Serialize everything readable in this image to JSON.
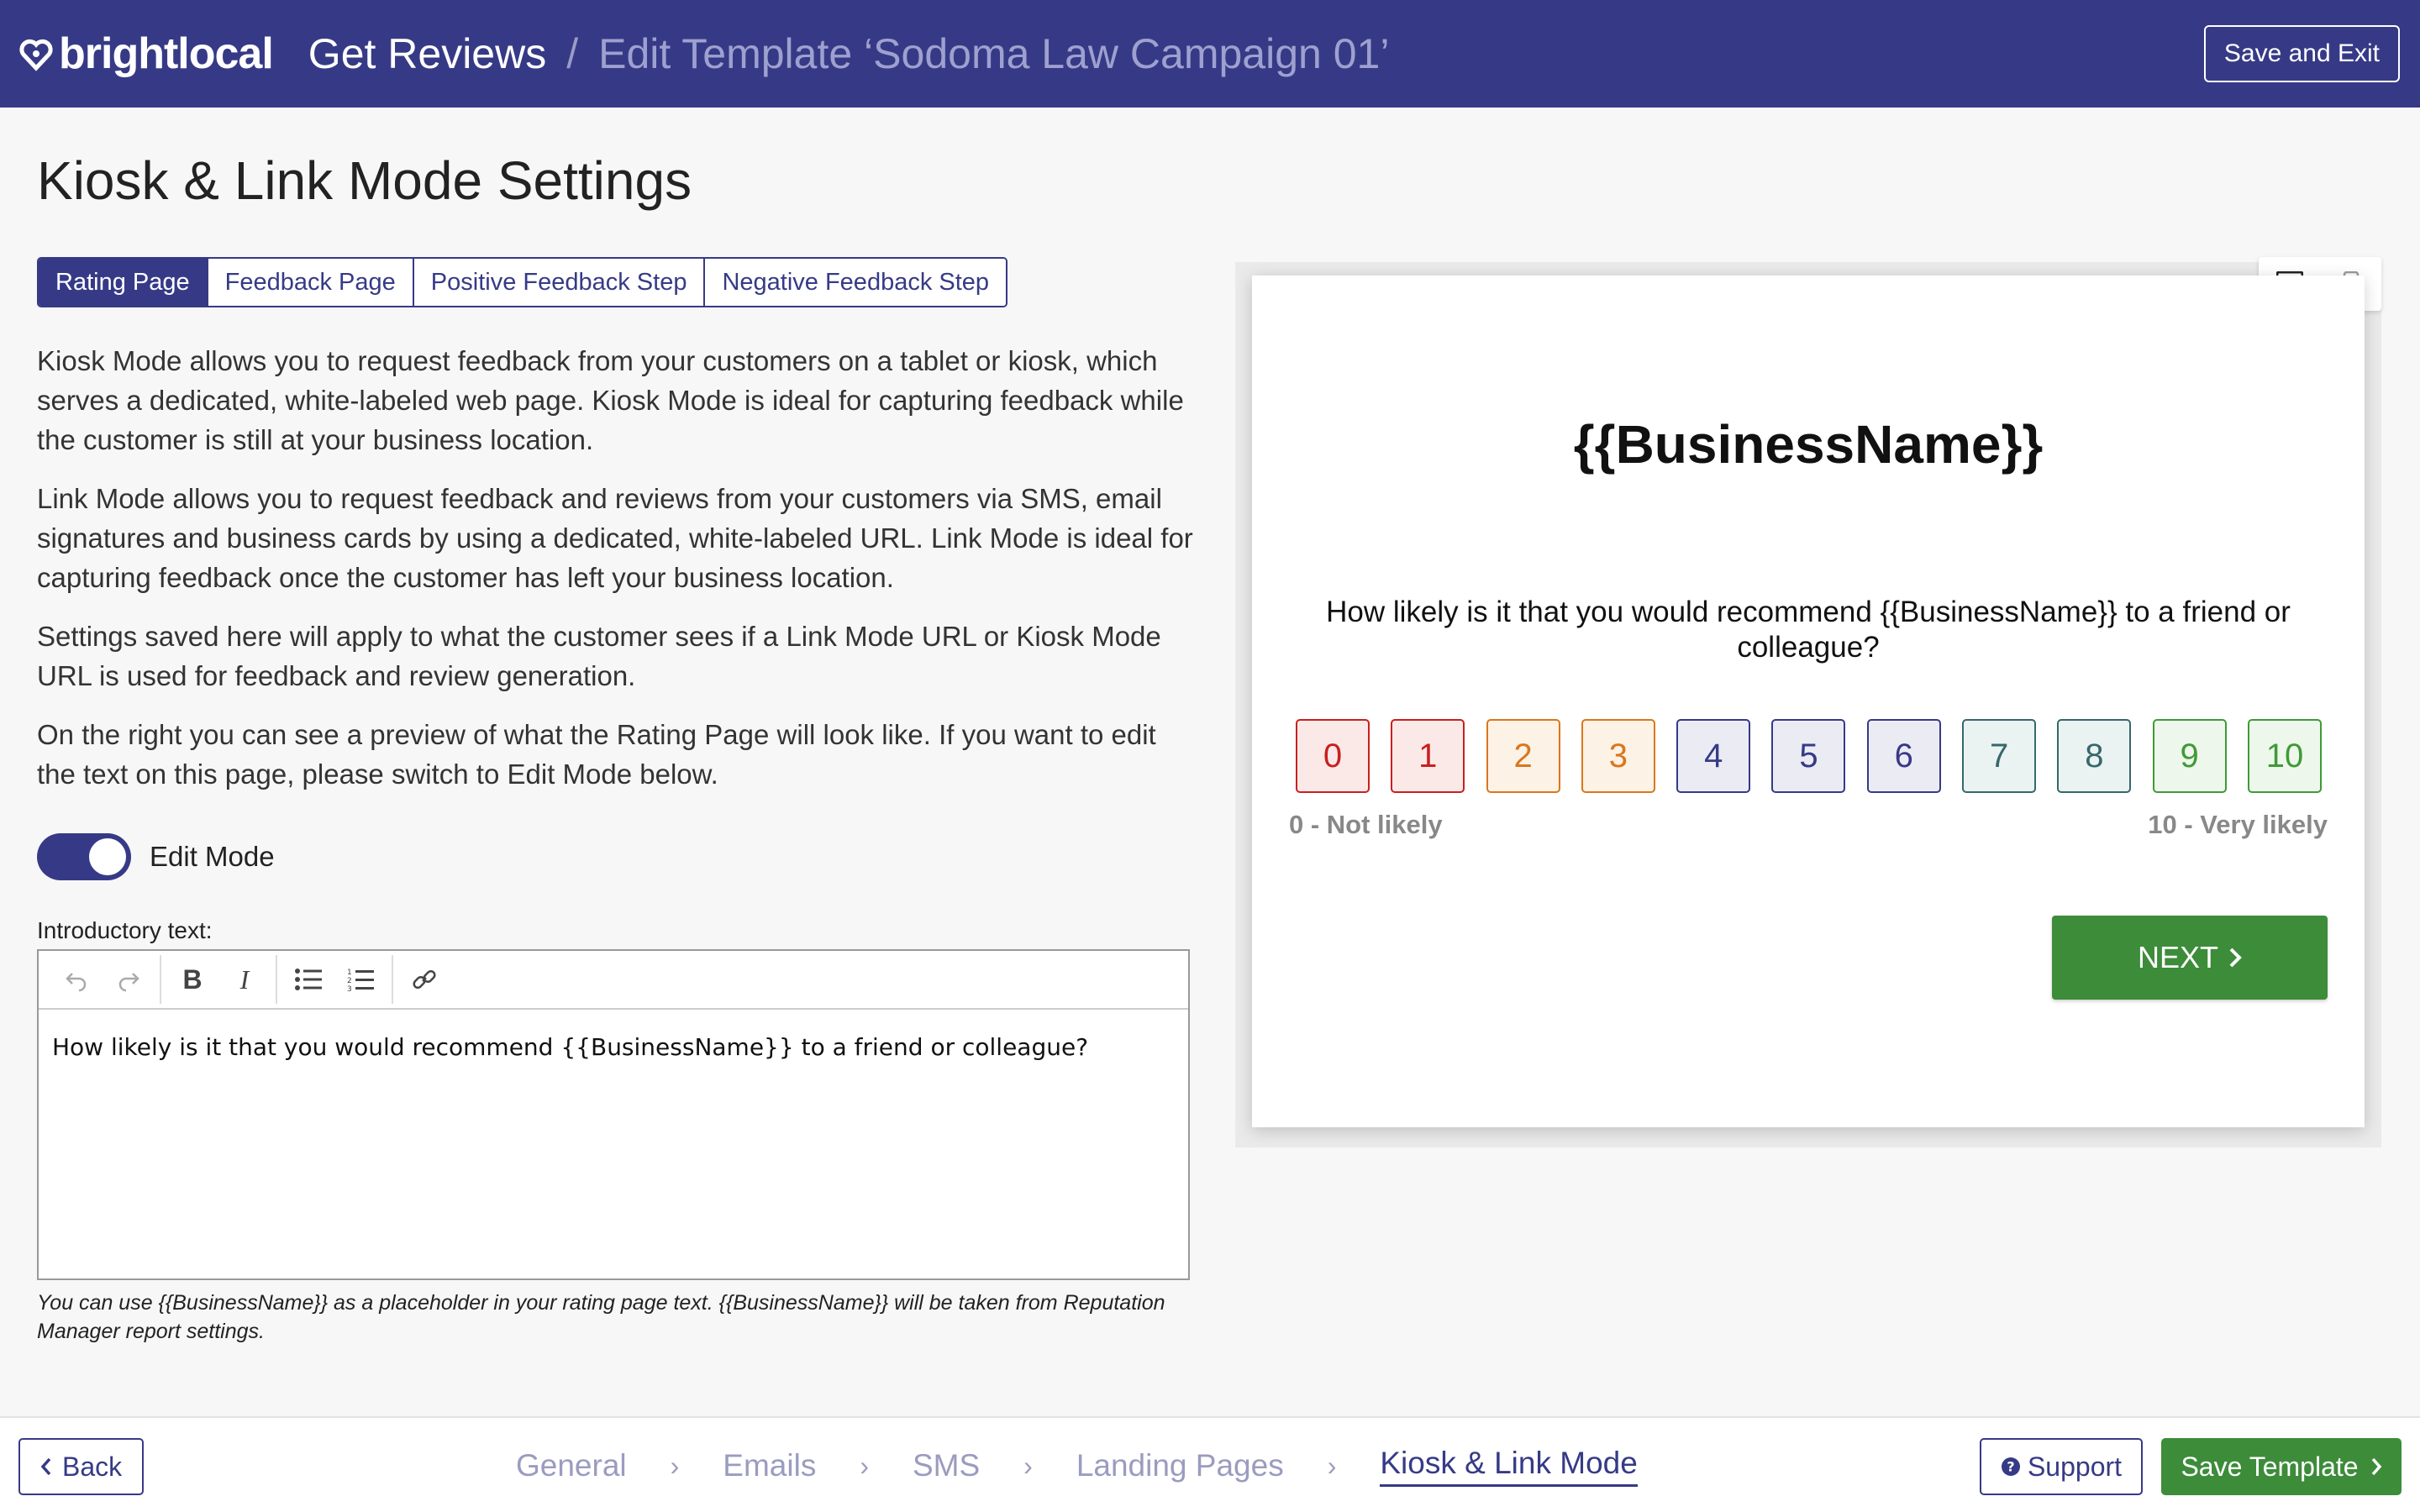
{
  "header": {
    "logo_text": "brightlocal",
    "breadcrumb_root": "Get Reviews",
    "breadcrumb_separator": "/",
    "breadcrumb_current": "Edit Template ‘Sodoma Law Campaign 01’",
    "save_exit_label": "Save and Exit",
    "bg_color": "#363a86"
  },
  "page": {
    "title": "Kiosk & Link Mode Settings",
    "tabs": [
      {
        "label": "Rating Page",
        "active": true
      },
      {
        "label": "Feedback Page",
        "active": false
      },
      {
        "label": "Positive Feedback Step",
        "active": false
      },
      {
        "label": "Negative Feedback Step",
        "active": false
      }
    ],
    "paragraphs": [
      "Kiosk Mode allows you to request feedback from your customers on a tablet or kiosk, which serves a dedicated, white-labeled web page. Kiosk Mode is ideal for capturing feedback while the customer is still at your business location.",
      "Link Mode allows you to request feedback and reviews from your customers via SMS, email signatures and business cards by using a dedicated, white-labeled URL. Link Mode is ideal for capturing feedback once the customer has left your business location.",
      "Settings saved here will apply to what the customer sees if a Link Mode URL or Kiosk Mode URL is used for feedback and review generation.",
      "On the right you can see a preview of what the Rating Page will look like. If you want to edit the text on this page, please switch to Edit Mode below."
    ],
    "edit_mode_label": "Edit Mode",
    "edit_mode_on": true,
    "intro_label": "Introductory text:",
    "intro_text": "How likely is it that you would recommend {{BusinessName}} to a friend or colleague?",
    "help_text": "You can use {{BusinessName}} as a placeholder in your rating page text. {{BusinessName}} will be taken from Reputation Manager report settings."
  },
  "toolbar_icons": [
    "undo-icon",
    "redo-icon",
    "bold-icon",
    "italic-icon",
    "bullet-list-icon",
    "numbered-list-icon",
    "link-icon"
  ],
  "preview": {
    "business_name": "{{BusinessName}}",
    "question": "How likely is it that you would recommend {{BusinessName}} to a friend or colleague?",
    "scores": [
      {
        "label": "0",
        "color": "#c8201f",
        "bg": "#fbe9e8"
      },
      {
        "label": "1",
        "color": "#c8201f",
        "bg": "#fbe9e8"
      },
      {
        "label": "2",
        "color": "#d9771c",
        "bg": "#fdf2e6"
      },
      {
        "label": "3",
        "color": "#d9771c",
        "bg": "#fdf2e6"
      },
      {
        "label": "4",
        "color": "#363a86",
        "bg": "#ebebf4"
      },
      {
        "label": "5",
        "color": "#363a86",
        "bg": "#ebebf4"
      },
      {
        "label": "6",
        "color": "#363a86",
        "bg": "#ebebf4"
      },
      {
        "label": "7",
        "color": "#35686a",
        "bg": "#ebf2f2"
      },
      {
        "label": "8",
        "color": "#35686a",
        "bg": "#ebf2f2"
      },
      {
        "label": "9",
        "color": "#3f9a36",
        "bg": "#eef7ec"
      },
      {
        "label": "10",
        "color": "#3f9a36",
        "bg": "#eef7ec"
      }
    ],
    "low_label": "0 - Not likely",
    "high_label": "10 - Very likely",
    "next_label": "NEXT"
  },
  "footer": {
    "back_label": "Back",
    "steps": [
      {
        "label": "General",
        "active": false
      },
      {
        "label": "Emails",
        "active": false
      },
      {
        "label": "SMS",
        "active": false
      },
      {
        "label": "Landing Pages",
        "active": false
      },
      {
        "label": "Kiosk & Link Mode",
        "active": true
      }
    ],
    "support_label": "Support",
    "save_label": "Save Template",
    "accent_green": "#3d8c3a"
  }
}
